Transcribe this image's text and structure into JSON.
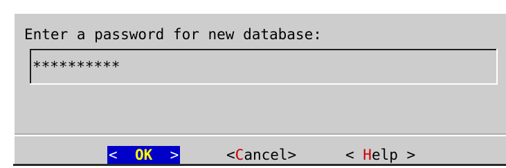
{
  "dialog": {
    "prompt": "Enter a password for new database:",
    "password_value": "**********",
    "buttons": {
      "ok": {
        "left_bracket": "<",
        "hotkey": "O",
        "rest": "K",
        "right_bracket": ">"
      },
      "cancel": {
        "left_bracket": "<",
        "hotkey": "C",
        "rest": "ancel",
        "right_bracket": ">"
      },
      "help": {
        "left_bracket": "< ",
        "hotkey": "H",
        "rest": "elp",
        "right_bracket": " >"
      }
    }
  },
  "colors": {
    "dialog_bg": "#cdcdcd",
    "focused_button_bg": "#0000c8",
    "focused_hotkey": "#ffff00",
    "hotkey": "#c80000"
  }
}
